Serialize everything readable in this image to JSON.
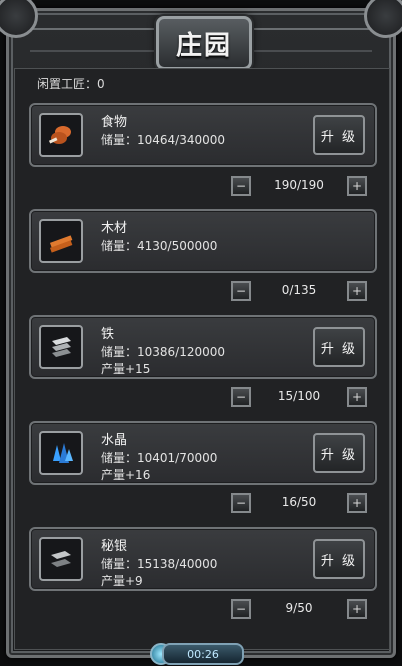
{
  "title": "庄园",
  "idle_label": "闲置工匠：0",
  "upgrade_label": "升 级",
  "resources": [
    {
      "name": "食物",
      "storage": "储量：10464/340000",
      "production": "",
      "count": "190/190",
      "icon": "meat-icon",
      "color": "#d86a2d"
    },
    {
      "name": "木材",
      "storage": "储量：4130/500000",
      "production": "",
      "count": "0/135",
      "icon": "wood-plank-icon",
      "color": "#e07a2f"
    },
    {
      "name": "铁",
      "storage": "储量：10386/120000",
      "production": "产量+15",
      "count": "15/100",
      "icon": "iron-ingot-icon",
      "color": "#bfc3c6"
    },
    {
      "name": "水晶",
      "storage": "储量：10401/70000",
      "production": "产量+16",
      "count": "16/50",
      "icon": "crystal-icon",
      "color": "#3aa0ff"
    },
    {
      "name": "秘银",
      "storage": "储量：15138/40000",
      "production": "产量+9",
      "count": "9/50",
      "icon": "mithril-ingot-icon",
      "color": "#a7abae"
    }
  ],
  "stepper": {
    "minus": "−",
    "plus": "+"
  },
  "timer": "00:26"
}
